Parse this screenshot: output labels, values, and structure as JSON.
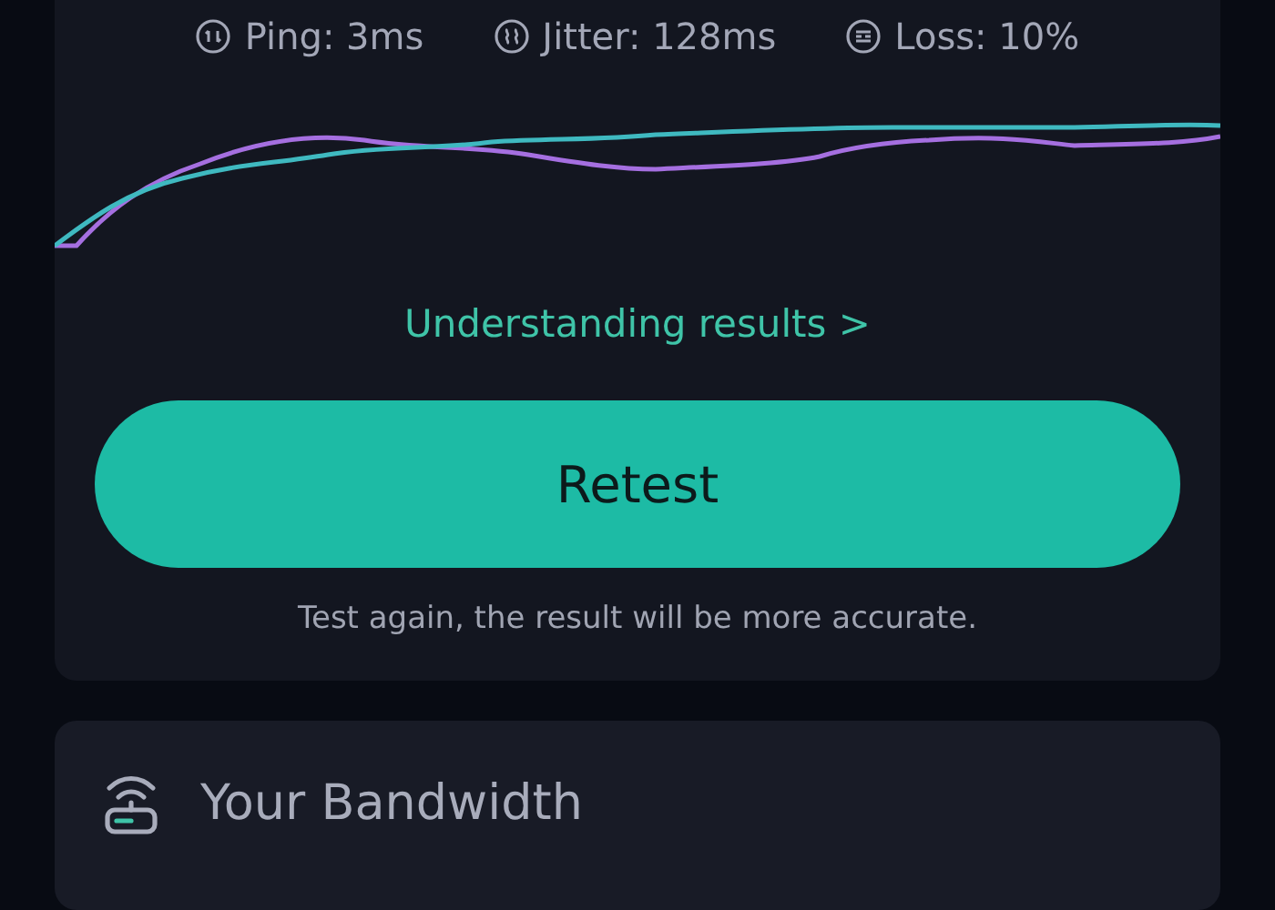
{
  "stats": [
    {
      "kind": "ping",
      "label": "Ping: 3ms"
    },
    {
      "kind": "jitter",
      "label": "Jitter: 128ms"
    },
    {
      "kind": "loss",
      "label": "Loss: 10%"
    }
  ],
  "link": "Understanding results >",
  "button": "Retest",
  "caption": "Test again, the result will be more accurate.",
  "bandwidth": {
    "title": "Your Bandwidth"
  }
}
